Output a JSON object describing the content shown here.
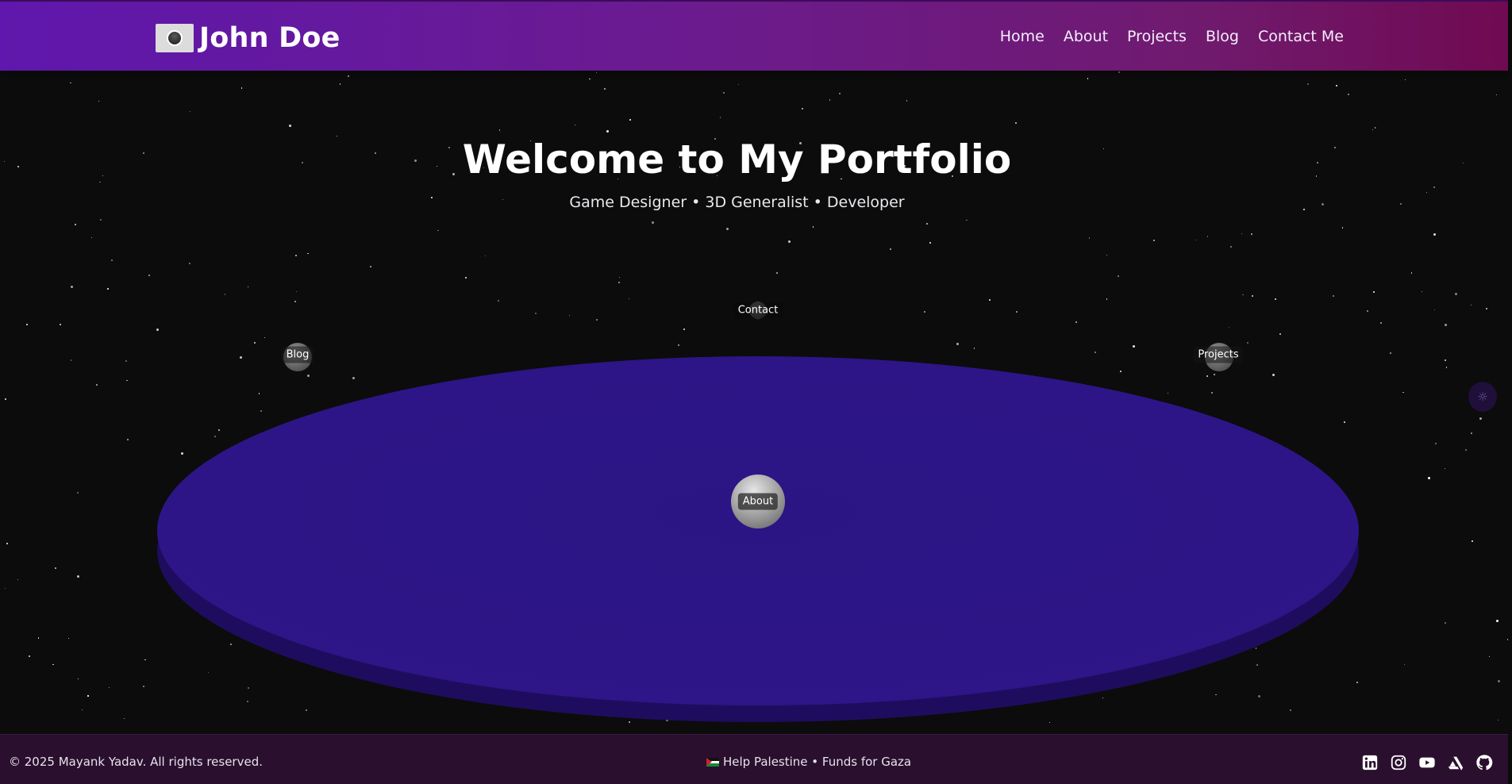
{
  "header": {
    "brand_name": "John Doe",
    "nav": [
      "Home",
      "About",
      "Projects",
      "Blog",
      "Contact Me"
    ]
  },
  "hero": {
    "title": "Welcome to My Portfolio",
    "subtitle": "Game Designer • 3D Generalist • Developer"
  },
  "planets": {
    "contact": "Contact",
    "blog": "Blog",
    "projects": "Projects",
    "about": "About"
  },
  "footer": {
    "copyright": "© 2025 Mayank Yadav. All rights reserved.",
    "help": "Help Palestine • Funds for Gaza",
    "socials": [
      "linkedin-icon",
      "instagram-icon",
      "youtube-icon",
      "artstation-icon",
      "github-icon"
    ]
  },
  "colors": {
    "header_start": "#5f17ad",
    "header_end": "#700a52",
    "platform": "#2d1585",
    "background": "#0c0c0c",
    "footer": "#2a0f2e"
  }
}
